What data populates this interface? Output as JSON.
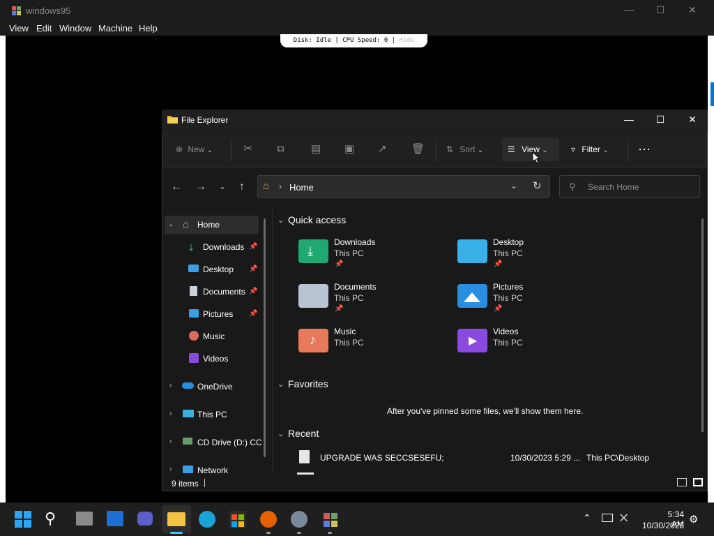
{
  "host": {
    "title": "windows95",
    "menu": [
      "View",
      "Edit",
      "Window",
      "Machine",
      "Help"
    ],
    "status": "Disk: Idle | CPU Speed: 0 |",
    "status_hide": "Hide"
  },
  "explorer": {
    "title": "File Explorer",
    "toolbar": {
      "new": "New",
      "sort": "Sort",
      "view": "View",
      "filter": "Filter"
    },
    "address": "Home",
    "search_placeholder": "Search Home",
    "nav": {
      "home": "Home",
      "downloads": "Downloads",
      "desktop": "Desktop",
      "documents": "Documents",
      "pictures": "Pictures",
      "music": "Music",
      "videos": "Videos",
      "onedrive": "OneDrive",
      "thispc": "This PC",
      "cddrive": "CD Drive (D:) CC",
      "network": "Network"
    },
    "sections": {
      "quick_access": "Quick access",
      "favorites": "Favorites",
      "favorites_empty": "After you've pinned some files, we'll show them here.",
      "recent": "Recent"
    },
    "quick_access": [
      {
        "name": "Downloads",
        "sub": "This PC"
      },
      {
        "name": "Desktop",
        "sub": "This PC"
      },
      {
        "name": "Documents",
        "sub": "This PC"
      },
      {
        "name": "Pictures",
        "sub": "This PC"
      },
      {
        "name": "Music",
        "sub": "This PC"
      },
      {
        "name": "Videos",
        "sub": "This PC"
      }
    ],
    "recent": [
      {
        "name": "UPGRADE WAS SECCSESEFU;",
        "date": "10/30/2023 5:29 ...",
        "location": "This PC\\Desktop"
      }
    ],
    "status": "9 items"
  },
  "taskbar": {
    "time": "5:34 AM",
    "date": "10/30/2023"
  }
}
